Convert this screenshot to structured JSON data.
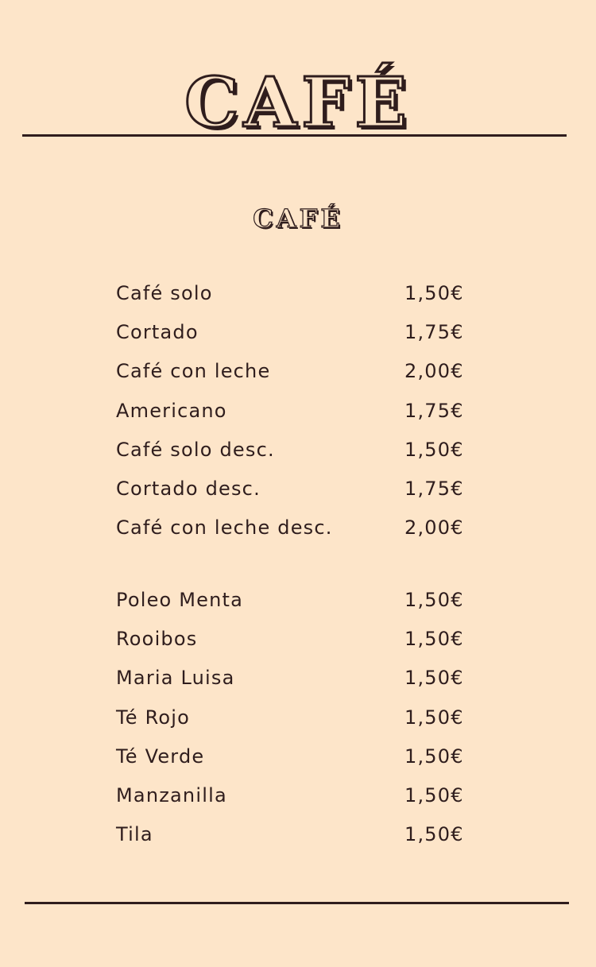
{
  "header": {
    "title": "CAFÉ"
  },
  "section": {
    "title": "CAFÉ"
  },
  "coffee_items": [
    {
      "name": "Café solo",
      "price": "1,50€"
    },
    {
      "name": "Cortado",
      "price": "1,75€"
    },
    {
      "name": "Café con leche",
      "price": "2,00€"
    },
    {
      "name": "Americano",
      "price": "1,75€"
    },
    {
      "name": "Café solo desc.",
      "price": "1,50€"
    },
    {
      "name": "Cortado desc.",
      "price": "1,75€"
    },
    {
      "name": "Café con leche desc.",
      "price": "2,00€"
    }
  ],
  "tea_items": [
    {
      "name": "Poleo Menta",
      "price": "1,50€"
    },
    {
      "name": "Rooibos",
      "price": "1,50€"
    },
    {
      "name": "Maria Luisa",
      "price": "1,50€"
    },
    {
      "name": "Té Rojo",
      "price": "1,50€"
    },
    {
      "name": "Té Verde",
      "price": "1,50€"
    },
    {
      "name": "Manzanilla",
      "price": "1,50€"
    },
    {
      "name": "Tila",
      "price": "1,50€"
    }
  ],
  "colors": {
    "background": "#fde5c9",
    "ink": "#2f1d1d"
  }
}
